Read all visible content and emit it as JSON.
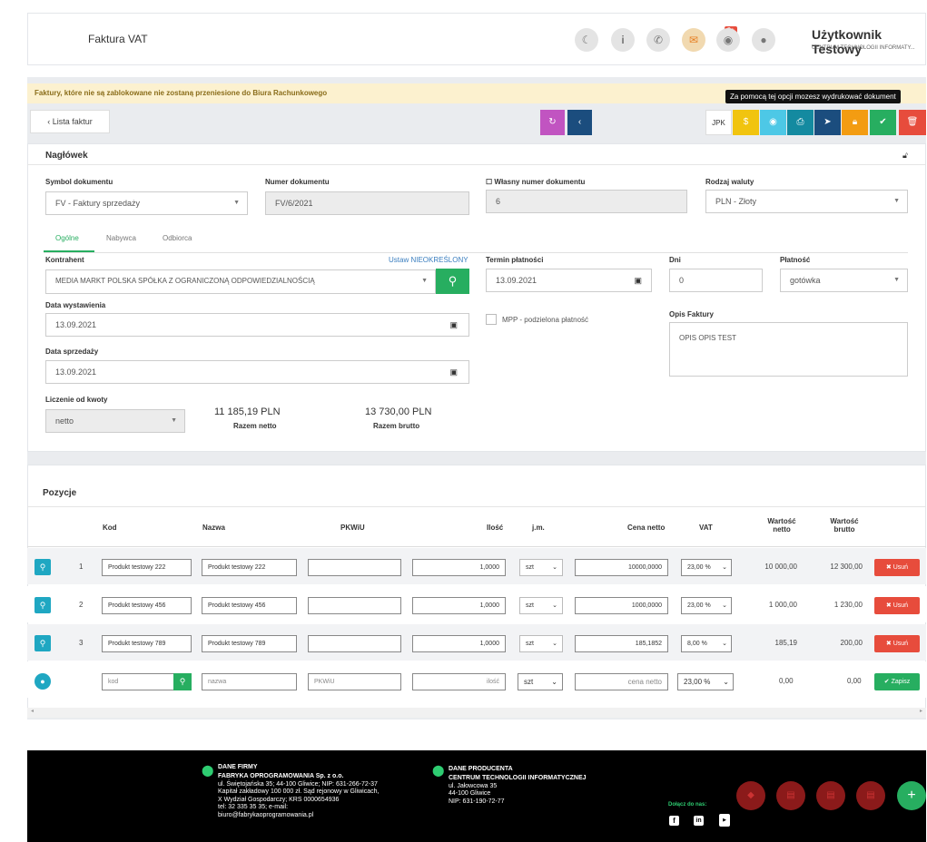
{
  "header": {
    "title": "Faktura VAT",
    "mail_badge": "9+",
    "user_name": "Użytkownik Testowy",
    "user_org": "CENTRUM TECHNOLOGII INFORMATY..."
  },
  "warning": "Faktury, które nie są zablokowane nie zostaną przeniesione do Biura Rachunkowego",
  "tooltip": "Za pomocą tej opcji mozesz wydrukować dokument",
  "toolbar": {
    "back": "‹  Lista faktur",
    "jpk": "JPK"
  },
  "colors": {
    "green": "#27ae60",
    "teal": "#1fa7c2",
    "red": "#e74c3c"
  },
  "naglowek": {
    "title": "Nagłówek",
    "symbol_label": "Symbol dokumentu",
    "symbol_value": "FV - Faktury sprzedaży",
    "numer_label": "Numer dokumentu",
    "numer_value": "FV/6/2021",
    "wlasny_label": "Własny numer dokumentu",
    "wlasny_value": "6",
    "waluta_label": "Rodzaj waluty",
    "waluta_value": "PLN - Złoty",
    "tabs": [
      "Ogólne",
      "Nabywca",
      "Odbiorca"
    ],
    "kontrahent_label": "Kontrahent",
    "kontrahent_link": "Ustaw NIEOKREŚLONY",
    "kontrahent_value": "MEDIA MARKT POLSKA SPÓŁKA Z OGRANICZONĄ ODPOWIEDZIALNOŚCIĄ",
    "termin_label": "Termin płatności",
    "termin_value": "13.09.2021",
    "dni_label": "Dni",
    "dni_value": "0",
    "platnosc_label": "Płatność",
    "platnosc_value": "gotówka",
    "wyst_label": "Data wystawienia",
    "wyst_value": "13.09.2021",
    "mpp_label": "MPP - podzielona płatność",
    "opis_label": "Opis Faktury",
    "opis_value": "OPIS OPIS TEST",
    "sprz_label": "Data sprzedaży",
    "sprz_value": "13.09.2021",
    "liczenie_label": "Liczenie od kwoty",
    "liczenie_value": "netto",
    "netto_amount": "11 185,19 PLN",
    "netto_label": "Razem netto",
    "brutto_amount": "13 730,00 PLN",
    "brutto_label": "Razem brutto"
  },
  "pozycje": {
    "title": "Pozycje",
    "headers": {
      "kod": "Kod",
      "nazwa": "Nazwa",
      "pkwiu": "PKWiU",
      "ilosc": "Ilość",
      "jm": "j.m.",
      "cena": "Cena netto",
      "vat": "VAT",
      "wn": "Wartość netto",
      "wb": "Wartość brutto"
    },
    "rows": [
      {
        "lp": "1",
        "kod": "Produkt testowy 222",
        "nazwa": "Produkt testowy 222",
        "pkwiu": "",
        "ilosc": "1,0000",
        "jm": "szt",
        "cena": "10000,0000",
        "vat": "23,00 %",
        "wn": "10 000,00",
        "wb": "12 300,00",
        "del": "✖  Usuń"
      },
      {
        "lp": "2",
        "kod": "Produkt testowy 456",
        "nazwa": "Produkt testowy 456",
        "pkwiu": "",
        "ilosc": "1,0000",
        "jm": "szt",
        "cena": "1000,0000",
        "vat": "23,00 %",
        "wn": "1 000,00",
        "wb": "1 230,00",
        "del": "✖  Usuń"
      },
      {
        "lp": "3",
        "kod": "Produkt testowy 789",
        "nazwa": "Produkt testowy 789",
        "pkwiu": "",
        "ilosc": "1,0000",
        "jm": "szt",
        "cena": "185,1852",
        "vat": "8,00 %",
        "wn": "185,19",
        "wb": "200,00",
        "del": "✖  Usuń"
      }
    ],
    "new_row": {
      "kod": "kod",
      "nazwa": "nazwa",
      "pkwiu": "PKWiU",
      "ilosc": "ilość",
      "jm": "szt",
      "cena": "cena netto",
      "vat": "23,00 %",
      "wn": "0,00",
      "wb": "0,00",
      "save": "✔  Zapisz"
    }
  },
  "footer": {
    "firma_title": "DANE FIRMY",
    "firma_lines": [
      "FABRYKA OPROGRAMOWANIA Sp. z o.o.",
      "ul. Świętojańska 35; 44-100 Gliwice; NIP: 631-266-72-37",
      "Kapitał zakładowy 100 000 zł. Sąd rejonowy w Gliwicach,",
      "X Wydział Gospodarczy; KRS 0000654936",
      "tel: 32 335 35 35; e-mail:",
      "biuro@fabrykaoprogramowania.pl"
    ],
    "prod_title": "DANE PRODUCENTA",
    "prod_lines": [
      "CENTRUM TECHNOLOGII INFORMATYCZNEJ",
      "ul. Jałowcowa 35",
      "44-100 Gliwice",
      "NIP: 631-190-72-77"
    ],
    "dolacz": "Dołącz do nas:"
  }
}
